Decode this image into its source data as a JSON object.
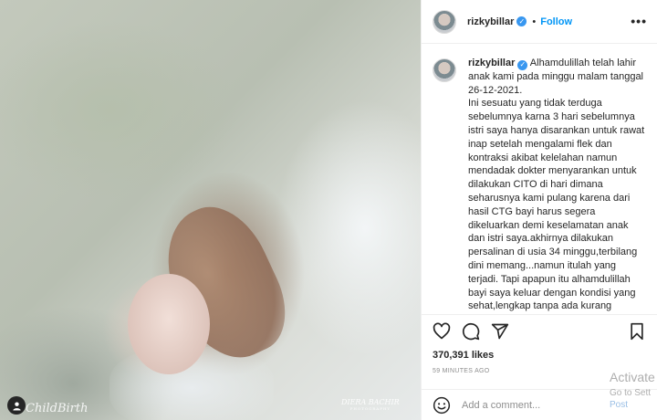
{
  "post": {
    "watermark_left": "ChildBirth",
    "watermark_right": "DIERA BACHIR",
    "watermark_right_sub": "PHOTOGRAPHY"
  },
  "header": {
    "username": "rizkybillar",
    "dot": "•",
    "follow_label": "Follow",
    "more_label": "•••"
  },
  "caption": {
    "username": "rizkybillar",
    "text": " Alhamdulillah telah lahir anak kami pada minggu malam tanggal 26-12-2021.\nIni sesuatu yang tidak terduga sebelumnya karna 3 hari sebelumnya istri saya hanya disarankan untuk rawat inap setelah mengalami flek dan kontraksi akibat kelelahan namun mendadak dokter menyarankan untuk dilakukan CITO di hari dimana seharusnya kami pulang karena dari hasil CTG bayi harus segera dikeluarkan demi keselamatan anak dan istri saya.akhirnya dilakukan persalinan di usia 34 minggu,terbilang dini memang...namun itulah yang terjadi. Tapi apapun itu alhamdulillah bayi saya keluar dengan kondisi yang sehat,lengkap tanpa ada kurang satupun..dan tangisan-nya yang"
  },
  "actions": {
    "like_icon": "heart-icon",
    "comment_icon": "comment-icon",
    "share_icon": "share-icon",
    "save_icon": "bookmark-icon"
  },
  "stats": {
    "likes": "370,391 likes",
    "time": "59 MINUTES AGO"
  },
  "comment_box": {
    "placeholder": "Add a comment...",
    "post_label": "Post"
  },
  "overlay": {
    "activate_title": "Activate",
    "activate_sub": "Go to Sett"
  },
  "colors": {
    "accent": "#0095f6",
    "verified": "#3897f0"
  }
}
